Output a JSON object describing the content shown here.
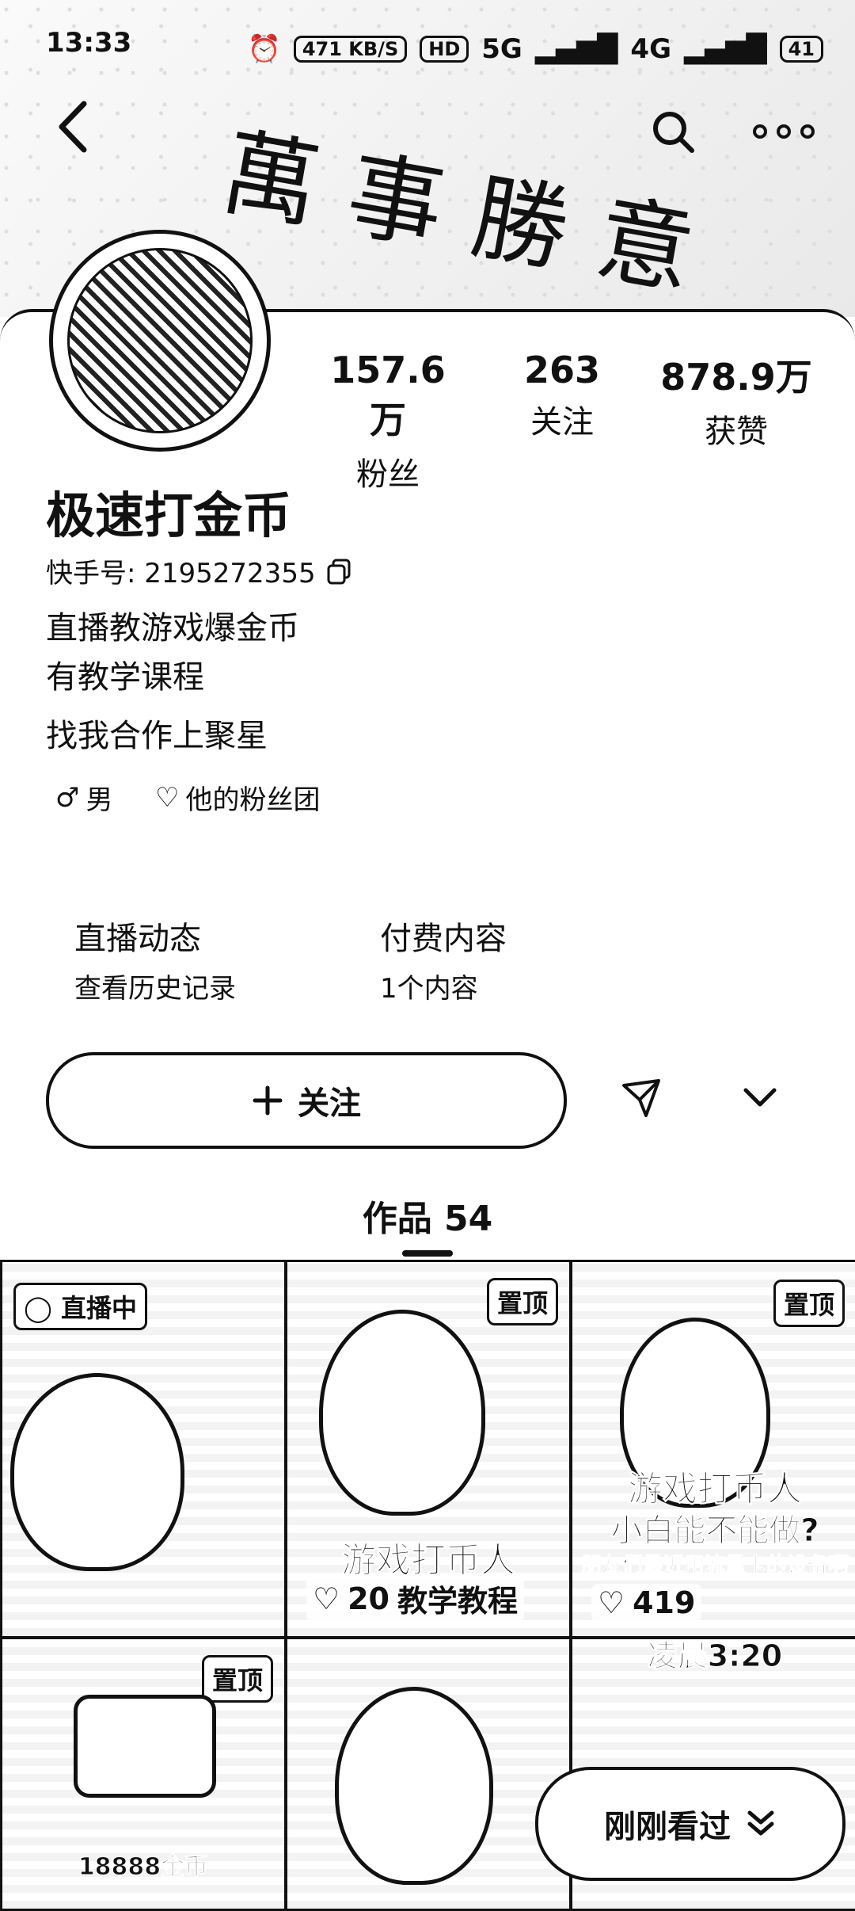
{
  "status_bar": {
    "time": "13:33",
    "net_speed": "471 KB/S",
    "hd": "HD",
    "sig1": "5G",
    "sig2": "4G",
    "battery": "41"
  },
  "banner": {
    "calligraphy": "萬事勝意"
  },
  "profile": {
    "name": "极速打金币",
    "kuaishou_id": "快手号: 2195272355",
    "bio_lines": [
      "直播教游戏爆金币",
      "有教学课程",
      "找我合作上聚星"
    ],
    "gender": "男",
    "fan_group": "他的粉丝团",
    "stats": [
      {
        "value": "157.6万",
        "label": "粉丝"
      },
      {
        "value": "263",
        "label": "关注"
      },
      {
        "value": "878.9万",
        "label": "获赞"
      }
    ]
  },
  "sections": [
    {
      "title": "直播动态",
      "subtitle": "查看历史记录"
    },
    {
      "title": "付费内容",
      "subtitle": "1个内容"
    }
  ],
  "actions": {
    "follow_label": "关注"
  },
  "tabs": {
    "works": "作品 54"
  },
  "videos": [
    {
      "badge": "直播中",
      "caption": ""
    },
    {
      "badge": "置顶",
      "caption": "游戏打币人",
      "caption2": "教学教程",
      "likes": "20"
    },
    {
      "badge": "置顶",
      "caption": "游戏打币人",
      "caption2": "小白能不能做?",
      "caption3": "朋友们最近用流量卡的设备啊",
      "likes": "419"
    },
    {
      "badge": "置顶",
      "caption": "18888金币"
    },
    {
      "badge": "",
      "caption": ""
    },
    {
      "badge": "",
      "caption": "凌晨3:20"
    }
  ],
  "recently_viewed": "刚刚看过"
}
